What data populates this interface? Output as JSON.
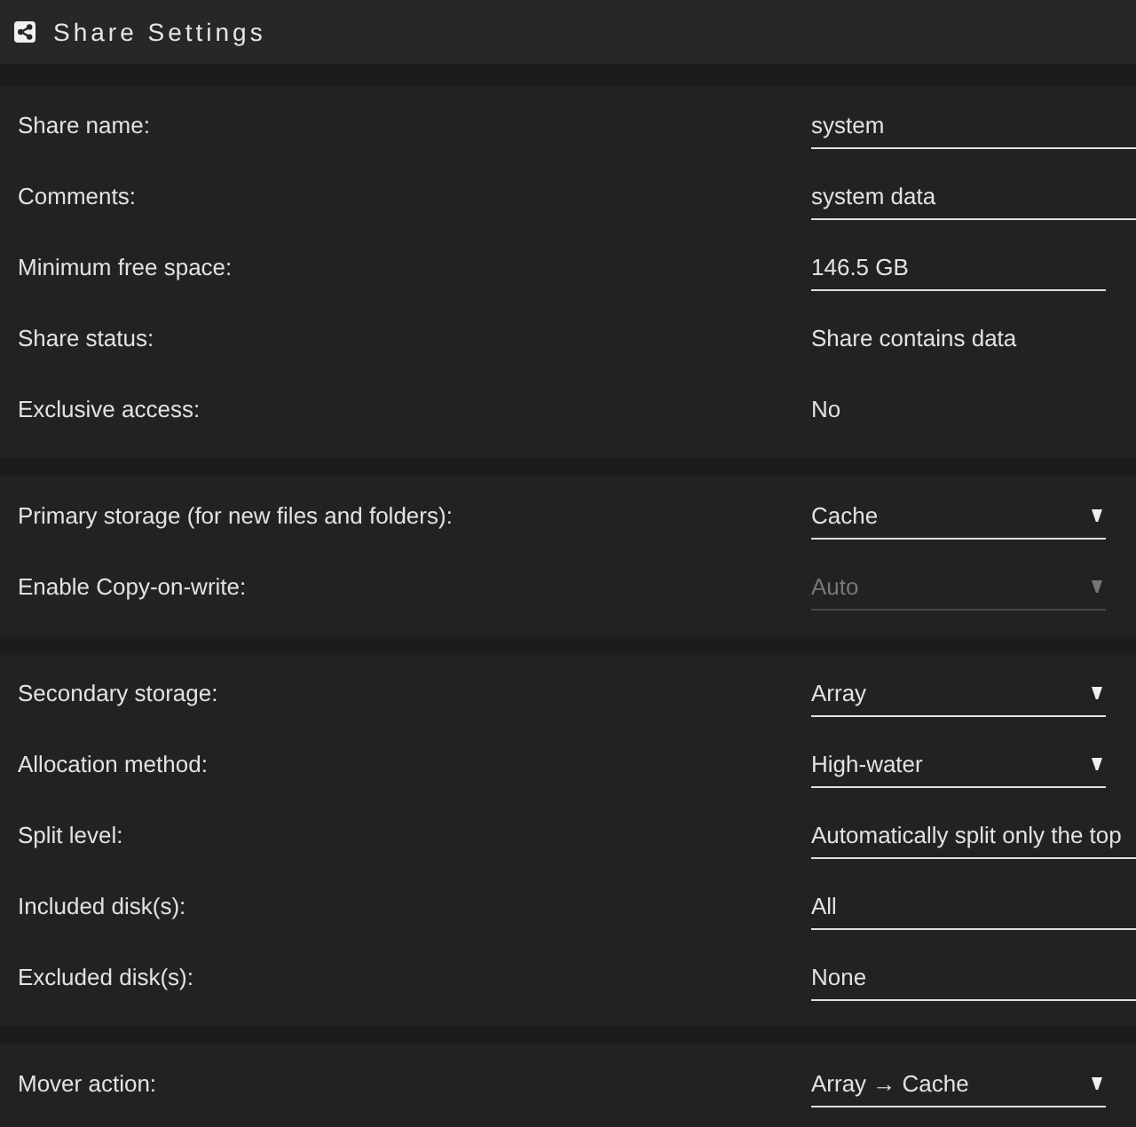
{
  "header": {
    "title": "Share Settings"
  },
  "sections": [
    {
      "rows": [
        {
          "label": "Share name:",
          "kind": "text",
          "value": "system",
          "disabled": false
        },
        {
          "label": "Comments:",
          "kind": "text",
          "value": "system data",
          "disabled": false
        },
        {
          "label": "Minimum free space:",
          "kind": "size",
          "value": "146.5 GB",
          "disabled": false
        },
        {
          "label": "Share status:",
          "kind": "static",
          "value": "Share contains data",
          "disabled": false
        },
        {
          "label": "Exclusive access:",
          "kind": "static",
          "value": "No",
          "disabled": false
        }
      ]
    },
    {
      "rows": [
        {
          "label": "Primary storage (for new files and folders):",
          "kind": "select",
          "value": "Cache",
          "disabled": false
        },
        {
          "label": "Enable Copy-on-write:",
          "kind": "select",
          "value": "Auto",
          "disabled": true
        }
      ]
    },
    {
      "rows": [
        {
          "label": "Secondary storage:",
          "kind": "select",
          "value": "Array",
          "disabled": false
        },
        {
          "label": "Allocation method:",
          "kind": "select",
          "value": "High-water",
          "disabled": false
        },
        {
          "label": "Split level:",
          "kind": "text",
          "value": "Automatically split only the top",
          "disabled": false
        },
        {
          "label": "Included disk(s):",
          "kind": "text",
          "value": "All",
          "disabled": false
        },
        {
          "label": "Excluded disk(s):",
          "kind": "text",
          "value": "None",
          "disabled": false
        }
      ]
    },
    {
      "rows": [
        {
          "label": "Mover action:",
          "kind": "select",
          "value": "Array → Cache",
          "disabled": false
        }
      ]
    }
  ]
}
